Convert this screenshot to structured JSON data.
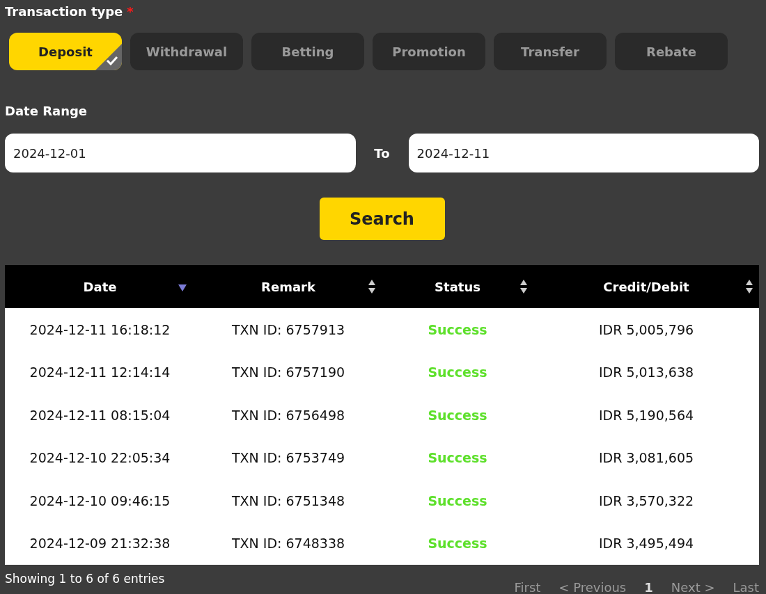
{
  "transaction_type": {
    "label": "Transaction type",
    "required_mark": "*",
    "options": [
      {
        "label": "Deposit",
        "selected": true
      },
      {
        "label": "Withdrawal",
        "selected": false
      },
      {
        "label": "Betting",
        "selected": false
      },
      {
        "label": "Promotion",
        "selected": false
      },
      {
        "label": "Transfer",
        "selected": false
      },
      {
        "label": "Rebate",
        "selected": false
      }
    ]
  },
  "date_range": {
    "label": "Date Range",
    "from": "2024-12-01",
    "separator": "To",
    "to": "2024-12-11"
  },
  "search_button": "Search",
  "table": {
    "columns": [
      {
        "label": "Date",
        "sorted": true
      },
      {
        "label": "Remark",
        "sorted": false
      },
      {
        "label": "Status",
        "sorted": false
      },
      {
        "label": "Credit/Debit",
        "sorted": false
      }
    ],
    "rows": [
      {
        "date": "2024-12-11 16:18:12",
        "remark": "TXN ID: 6757913",
        "status": "Success",
        "color": "#5ee02c",
        "amount": "IDR 5,005,796"
      },
      {
        "date": "2024-12-11 12:14:14",
        "remark": "TXN ID: 6757190",
        "status": "Success",
        "color": "#5ee02c",
        "amount": "IDR 5,013,638"
      },
      {
        "date": "2024-12-11 08:15:04",
        "remark": "TXN ID: 6756498",
        "status": "Success",
        "color": "#5ee02c",
        "amount": "IDR 5,190,564"
      },
      {
        "date": "2024-12-10 22:05:34",
        "remark": "TXN ID: 6753749",
        "status": "Success",
        "color": "#5ee02c",
        "amount": "IDR 3,081,605"
      },
      {
        "date": "2024-12-10 09:46:15",
        "remark": "TXN ID: 6751348",
        "status": "Success",
        "color": "#5ee02c",
        "amount": "IDR 3,570,322"
      },
      {
        "date": "2024-12-09 21:32:38",
        "remark": "TXN ID: 6748338",
        "status": "Success",
        "color": "#5ee02c",
        "amount": "IDR 3,495,494"
      }
    ]
  },
  "footer": {
    "summary": "Showing 1 to 6 of 6 entries",
    "pagination": [
      {
        "label": "First",
        "selected": false
      },
      {
        "label": "< Previous",
        "selected": false
      },
      {
        "label": "1",
        "selected": true
      },
      {
        "label": "Next >",
        "selected": false
      },
      {
        "label": "Last",
        "selected": false
      }
    ]
  }
}
